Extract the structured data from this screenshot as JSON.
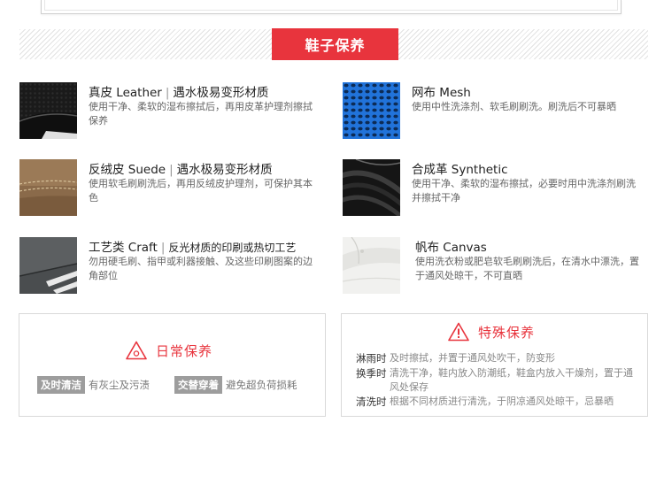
{
  "section": {
    "banner_title": "鞋子保养"
  },
  "materials": [
    {
      "name": "真皮 Leather",
      "note": "遇水极易变形材质",
      "desc": "使用干净、柔软的湿布擦拭后，再用皮革护理剂擦拭保养",
      "texture": "leather"
    },
    {
      "name": "网布 Mesh",
      "note": "",
      "desc": "使用中性洗涤剂、软毛刷刷洗。刷洗后不可暴晒",
      "texture": "mesh"
    },
    {
      "name": "反绒皮 Suede",
      "note": "遇水极易变形材质",
      "desc": "使用软毛刷刷洗后，再用反绒皮护理剂，可保护其本色",
      "texture": "suede"
    },
    {
      "name": "合成革 Synthetic",
      "note": "",
      "desc": "使用干净、柔软的湿布擦拭，必要时用中洗涤剂刷洗并擦拭干净",
      "texture": "synthetic"
    },
    {
      "name": "工艺类 Craft",
      "note": "反光材质的印刷或热切工艺",
      "desc": "勿用硬毛刷、指甲或利器接触、及这些印刷图案的边角部位",
      "texture": "craft"
    },
    {
      "name": "帆布 Canvas",
      "note": "",
      "desc": "使用洗衣粉或肥皂软毛刷刷洗后，在清水中漂洗，置于通风处晾干，不可直晒",
      "texture": "canvas"
    }
  ],
  "daily_care": {
    "title": "日常保养",
    "items": [
      {
        "tag": "及时清洁",
        "text": "有灰尘及污渍"
      },
      {
        "tag": "交替穿着",
        "text": "避免超负荷损耗"
      }
    ]
  },
  "special_care": {
    "title": "特殊保养",
    "rows": [
      {
        "label": "淋雨时",
        "text": "及时擦拭，并置于通风处吹干，防变形"
      },
      {
        "label": "换季时",
        "text": "清洗干净，鞋内放入防潮纸，鞋盒内放入干燥剂，置于通风处保存"
      },
      {
        "label": "清洗时",
        "text": "根据不同材质进行清洗，于阴凉通风处晾干，忌暴晒"
      }
    ]
  },
  "colors": {
    "accent": "#e8343d",
    "tag_bg": "#9d9d9d",
    "mesh_blue": "#1d6fd6"
  }
}
